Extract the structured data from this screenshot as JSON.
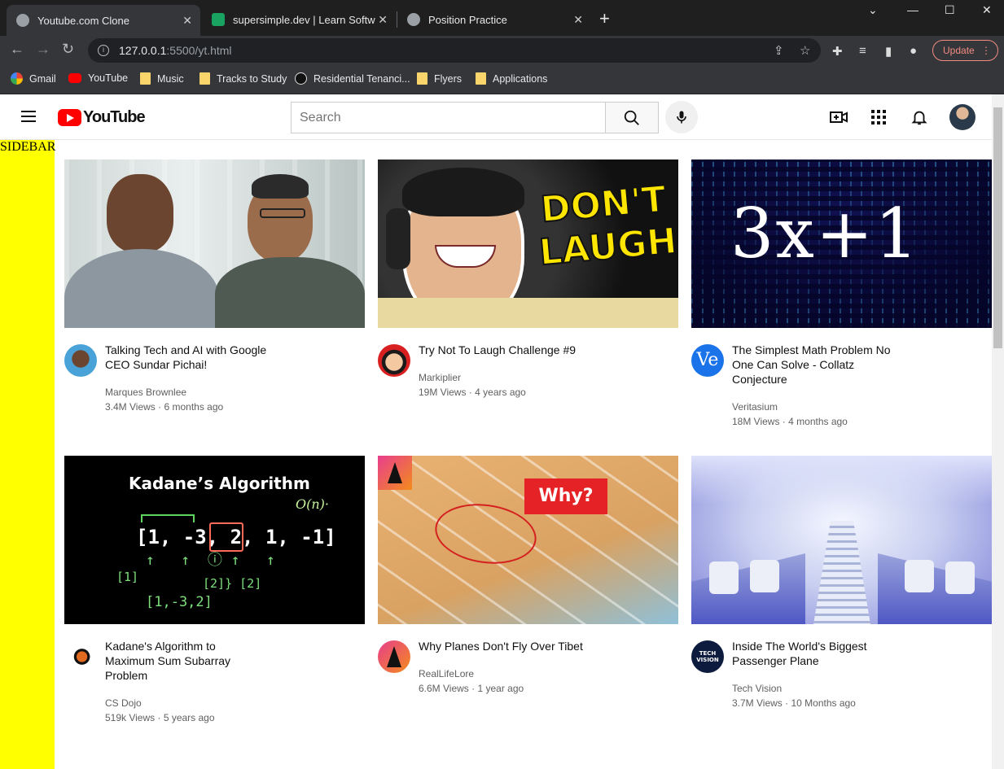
{
  "browser": {
    "tabs": [
      {
        "title": "Youtube.com Clone",
        "active": true
      },
      {
        "title": "supersimple.dev | Learn Software",
        "active": false
      },
      {
        "title": "Position Practice",
        "active": false
      }
    ],
    "url_host": "127.0.0.1",
    "url_rest": ":5500/yt.html",
    "update_label": "Update",
    "bookmarks": [
      "Gmail",
      "YouTube",
      "Music",
      "Tracks to Study",
      "Residential Tenanci...",
      "Flyers",
      "Applications"
    ]
  },
  "header": {
    "logo_text": "YouTube",
    "search_placeholder": "Search"
  },
  "sidebar": {
    "label": "SIDEBAR"
  },
  "videos": [
    {
      "title": "Talking Tech and AI with Google CEO Sundar Pichai!",
      "channel": "Marques Brownlee",
      "stats": "3.4M Views · 6 months ago"
    },
    {
      "title": "Try Not To Laugh Challenge #9",
      "channel": "Markiplier",
      "stats": "19M Views · 4 years ago",
      "thumb_text_1": "DON'T",
      "thumb_text_2": "LAUGH"
    },
    {
      "title": "The Simplest Math Problem No One Can Solve - Collatz Conjecture",
      "channel": "Veritasium",
      "stats": "18M Views · 4 months ago",
      "thumb_text": "3x+1",
      "avatar_text": "Ve"
    },
    {
      "title": "Kadane's Algorithm to Maximum Sum Subarray Problem",
      "channel": "CS Dojo",
      "stats": "519k Views · 5 years ago",
      "thumb_text": "Kadane’s Algorithm",
      "thumb_array": "[1, -3, 2, 1, -1]"
    },
    {
      "title": "Why Planes Don't Fly Over Tibet",
      "channel": "RealLifeLore",
      "stats": "6.6M Views · 1 year ago",
      "thumb_text": "Why?"
    },
    {
      "title": "Inside The World's Biggest Passenger Plane",
      "channel": "Tech Vision",
      "stats": "3.7M Views · 10 Months ago",
      "avatar_text": "TECH VISION"
    }
  ]
}
